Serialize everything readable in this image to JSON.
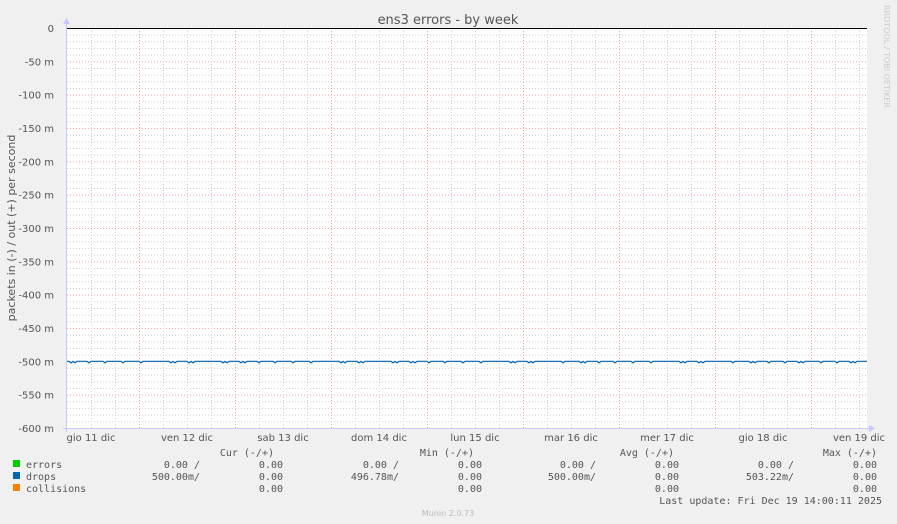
{
  "chart_data": {
    "type": "line",
    "title": "ens3 errors - by week",
    "ylabel": "packets in (-) / out (+) per second",
    "ylim": [
      -600,
      0
    ],
    "yticks": [
      0,
      -50,
      -100,
      -150,
      -200,
      -250,
      -300,
      -350,
      -400,
      -450,
      -500,
      -550,
      -600
    ],
    "ytick_labels": [
      "0",
      "-50 m",
      "-100 m",
      "-150 m",
      "-200 m",
      "-250 m",
      "-300 m",
      "-350 m",
      "-400 m",
      "-450 m",
      "-500 m",
      "-550 m",
      "-600 m"
    ],
    "xtick_labels": [
      "gio 11 dic",
      "ven 12 dic",
      "sab 13 dic",
      "dom 14 dic",
      "lun 15 dic",
      "mar 16 dic",
      "mer 17 dic",
      "gio 18 dic",
      "ven 19 dic"
    ],
    "grid": true,
    "watermark": "RRDTOOL / TOBI OETIKER",
    "series": [
      {
        "name": "errors",
        "color": "#00cc00",
        "in_value": 0,
        "out_value": 0
      },
      {
        "name": "drops",
        "color": "#0066b3",
        "in_value": -500,
        "in_min": -503.22,
        "in_max": -496.78,
        "out_value": 0
      },
      {
        "name": "collisions",
        "color": "#ff8000",
        "out_value": 0
      }
    ]
  },
  "legend": {
    "headers": [
      "Cur (-/+)",
      "Min (-/+)",
      "Avg (-/+)",
      "Max (-/+)"
    ],
    "rows": [
      {
        "label": "errors",
        "color": "#00cc00",
        "cells": [
          "0.00 /",
          "0.00",
          "0.00 /",
          "0.00",
          "0.00 /",
          "0.00",
          "0.00 /",
          "0.00"
        ]
      },
      {
        "label": "drops",
        "color": "#0066b3",
        "cells": [
          "500.00m/",
          "0.00",
          "496.78m/",
          "0.00",
          "500.00m/",
          "0.00",
          "503.22m/",
          "0.00"
        ]
      },
      {
        "label": "collisions",
        "color": "#ff8000",
        "cells": [
          "",
          "0.00",
          "",
          "0.00",
          "",
          "0.00",
          "",
          "0.00"
        ]
      }
    ],
    "last_update": "Last update: Fri Dec 19 14:00:11 2025"
  },
  "footer": "Munin 2.0.73"
}
